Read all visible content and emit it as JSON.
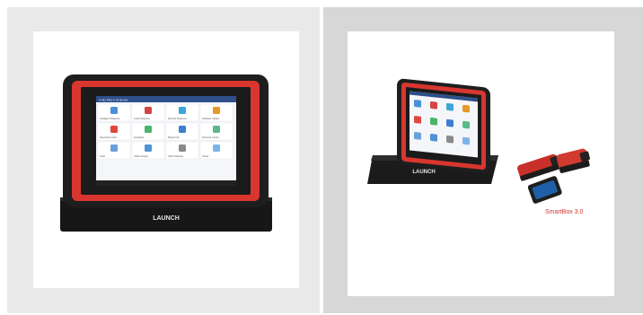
{
  "products": [
    {
      "brand_label": "LAUNCH"
    },
    {
      "brand_label": "LAUNCH",
      "accessory_label": "SmartBox 3.0"
    }
  ],
  "screen": {
    "status_text": "X-431 PAD V  V5.00.019",
    "apps": [
      {
        "label": "Intelligent Diagnose",
        "color": "#4a90d9"
      },
      {
        "label": "Local Diagnose",
        "color": "#d64545"
      },
      {
        "label": "Remote Diagnose",
        "color": "#3aa7d8"
      },
      {
        "label": "Software Update",
        "color": "#e49a2a"
      },
      {
        "label": "Special Function",
        "color": "#e0473d"
      },
      {
        "label": "Feedback",
        "color": "#4bb36b"
      },
      {
        "label": "Repair Info",
        "color": "#3d7fd0"
      },
      {
        "label": "Personal Center",
        "color": "#5bb98c"
      },
      {
        "label": "Tools",
        "color": "#6aa0dc"
      },
      {
        "label": "Tablet Setting",
        "color": "#4f92d6"
      },
      {
        "label": "Other Modules",
        "color": "#8a8a8a"
      },
      {
        "label": "Cloud",
        "color": "#7bb4e8"
      }
    ]
  },
  "colors": {
    "frame_red": "#d8362f",
    "bezel": "#1b1b1b",
    "screen_bg": "#f4f6f9",
    "statusbar": "#2e4f8a"
  }
}
